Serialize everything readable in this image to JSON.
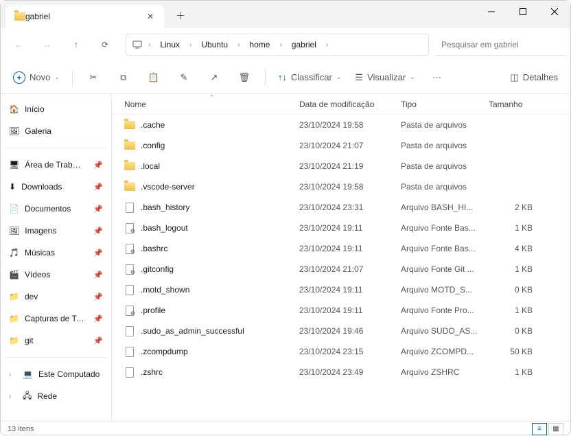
{
  "tab": {
    "title": "gabriel"
  },
  "breadcrumb": [
    "Linux",
    "Ubuntu",
    "home",
    "gabriel"
  ],
  "search": {
    "placeholder": "Pesquisar em gabriel"
  },
  "toolbar": {
    "novo": "Novo",
    "classificar": "Classificar",
    "visualizar": "Visualizar",
    "detalhes": "Detalhes"
  },
  "sidebar": {
    "home": "Início",
    "gallery": "Galeria",
    "pinned": [
      {
        "label": "Área de Trab…",
        "icon": "desktop"
      },
      {
        "label": "Downloads",
        "icon": "downloads"
      },
      {
        "label": "Documentos",
        "icon": "documents"
      },
      {
        "label": "Imagens",
        "icon": "pictures"
      },
      {
        "label": "Músicas",
        "icon": "music"
      },
      {
        "label": "Vídeos",
        "icon": "videos"
      },
      {
        "label": "dev",
        "icon": "folder"
      },
      {
        "label": "Capturas de Tel…",
        "icon": "folder"
      },
      {
        "label": "git",
        "icon": "folder"
      }
    ],
    "thispc": "Este Computado",
    "network": "Rede"
  },
  "columns": {
    "name": "Nome",
    "date": "Data de modificação",
    "type": "Tipo",
    "size": "Tamanho"
  },
  "files": [
    {
      "name": ".cache",
      "date": "23/10/2024 19:58",
      "type": "Pasta de arquivos",
      "size": "",
      "kind": "folder"
    },
    {
      "name": ".config",
      "date": "23/10/2024 21:07",
      "type": "Pasta de arquivos",
      "size": "",
      "kind": "folder"
    },
    {
      "name": ".local",
      "date": "23/10/2024 21:19",
      "type": "Pasta de arquivos",
      "size": "",
      "kind": "folder"
    },
    {
      "name": ".vscode-server",
      "date": "23/10/2024 19:58",
      "type": "Pasta de arquivos",
      "size": "",
      "kind": "folder"
    },
    {
      "name": ".bash_history",
      "date": "23/10/2024 23:31",
      "type": "Arquivo BASH_HI...",
      "size": "2 KB",
      "kind": "file"
    },
    {
      "name": ".bash_logout",
      "date": "23/10/2024 19:11",
      "type": "Arquivo Fonte Bas...",
      "size": "1 KB",
      "kind": "cfg"
    },
    {
      "name": ".bashrc",
      "date": "23/10/2024 19:11",
      "type": "Arquivo Fonte Bas...",
      "size": "4 KB",
      "kind": "cfg"
    },
    {
      "name": ".gitconfig",
      "date": "23/10/2024 21:07",
      "type": "Arquivo Fonte Git ...",
      "size": "1 KB",
      "kind": "cfg"
    },
    {
      "name": ".motd_shown",
      "date": "23/10/2024 19:11",
      "type": "Arquivo MOTD_S...",
      "size": "0 KB",
      "kind": "file"
    },
    {
      "name": ".profile",
      "date": "23/10/2024 19:11",
      "type": "Arquivo Fonte Pro...",
      "size": "1 KB",
      "kind": "cfg"
    },
    {
      "name": ".sudo_as_admin_successful",
      "date": "23/10/2024 19:46",
      "type": "Arquivo SUDO_AS...",
      "size": "0 KB",
      "kind": "file"
    },
    {
      "name": ".zcompdump",
      "date": "23/10/2024 23:15",
      "type": "Arquivo ZCOMPD...",
      "size": "50 KB",
      "kind": "file"
    },
    {
      "name": ".zshrc",
      "date": "23/10/2024 23:49",
      "type": "Arquivo ZSHRC",
      "size": "1 KB",
      "kind": "file"
    }
  ],
  "status": {
    "count": "13 itens"
  }
}
